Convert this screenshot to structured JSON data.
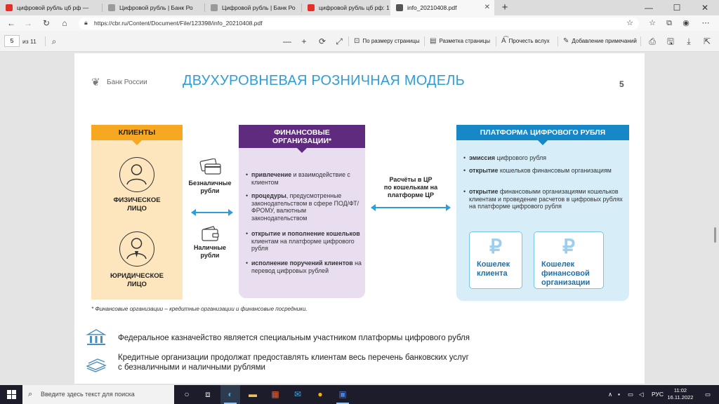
{
  "browser": {
    "tabs": [
      {
        "title": "цифровой рубль цб рф —",
        "favicon_color": "#e5302a"
      },
      {
        "title": "Цифровой рубль | Банк Ро",
        "favicon_color": "#9a9a9a"
      },
      {
        "title": "Цифровой рубль | Банк Ро",
        "favicon_color": "#9a9a9a"
      },
      {
        "title": "цифровой рубль цб рф: 1",
        "favicon_color": "#e5302a"
      },
      {
        "title": "info_20210408.pdf",
        "favicon_color": "#555555"
      }
    ],
    "new_tab": "+",
    "url": "https://cbr.ru/Content/Document/File/123398/info_20210408.pdf"
  },
  "pdf_toolbar": {
    "page": "5",
    "of": "из 11",
    "zoom_out": "—",
    "zoom_in": "+",
    "fit_page": "По размеру страницы",
    "page_layout": "Разметка страницы",
    "read_aloud": "Прочесть вслух",
    "add_notes": "Добавление примечаний"
  },
  "slide": {
    "logo_text": "Банк России",
    "title": "ДВУХУРОВНЕВАЯ РОЗНИЧНАЯ МОДЕЛЬ",
    "page_number": "5",
    "clients": {
      "header": "КЛИЕНТЫ",
      "individual_l1": "ФИЗИЧЕСКОЕ",
      "individual_l2": "ЛИЦО",
      "legal_l1": "ЮРИДИЧЕСКОЕ",
      "legal_l2": "ЛИЦО"
    },
    "payments": {
      "cashless_l1": "Безналичные",
      "cashless_l2": "рубли",
      "cash_l1": "Наличные",
      "cash_l2": "рубли"
    },
    "finorg": {
      "header_l1": "ФИНАНСОВЫЕ",
      "header_l2": "ОРГАНИЗАЦИИ*",
      "items": [
        {
          "bold": "привлечение",
          "rest": " и взаимодействие с клиентом"
        },
        {
          "bold": "процедуры",
          "rest": ", предусмотренные законодательством в сфере ПОД/ФТ/ФРОМУ, валютным законодательством"
        },
        {
          "bold": "открытие и пополнение кошельков",
          "rest": " клиентам на платформе цифрового рубля"
        },
        {
          "bold": "исполнение поручений клиентов",
          "rest": " на перевод цифровых рублей"
        }
      ]
    },
    "settlement": {
      "l1": "Расчёты в ЦР",
      "l2": "по кошелькам на",
      "l3": "платформе ЦР"
    },
    "platform": {
      "header": "ПЛАТФОРМА ЦИФРОВОГО РУБЛЯ",
      "items": [
        {
          "bold": "эмиссия",
          "rest": " цифрового рубля"
        },
        {
          "bold": "открытие",
          "rest": " кошельков финансовым организациям"
        },
        {
          "bold": "открытие",
          "rest": " финансовыми организациями кошельков клиентам и проведение расчетов в цифровых рублях на платформе цифрового рубля"
        }
      ],
      "wallet_client_l1": "Кошелек",
      "wallet_client_l2": "клиента",
      "wallet_org_l1": "Кошелек",
      "wallet_org_l2": "финансовой",
      "wallet_org_l3": "организации",
      "ruble_sign": "₽"
    },
    "footnote": "* Финансовые организации – кредитные организации и финансовые посредники.",
    "facts": {
      "treasury": "Федеральное казначейство является специальным участником платформы цифрового рубля",
      "credit_l1": "Кредитные организации продолжат предоставлять клиентам весь перечень банковских услуг",
      "credit_l2": "с безналичными и наличными рублями"
    }
  },
  "taskbar": {
    "search_placeholder": "Введите здесь текст для поиска",
    "language": "РУС",
    "time": "11:02",
    "date": "16.11.2022"
  }
}
